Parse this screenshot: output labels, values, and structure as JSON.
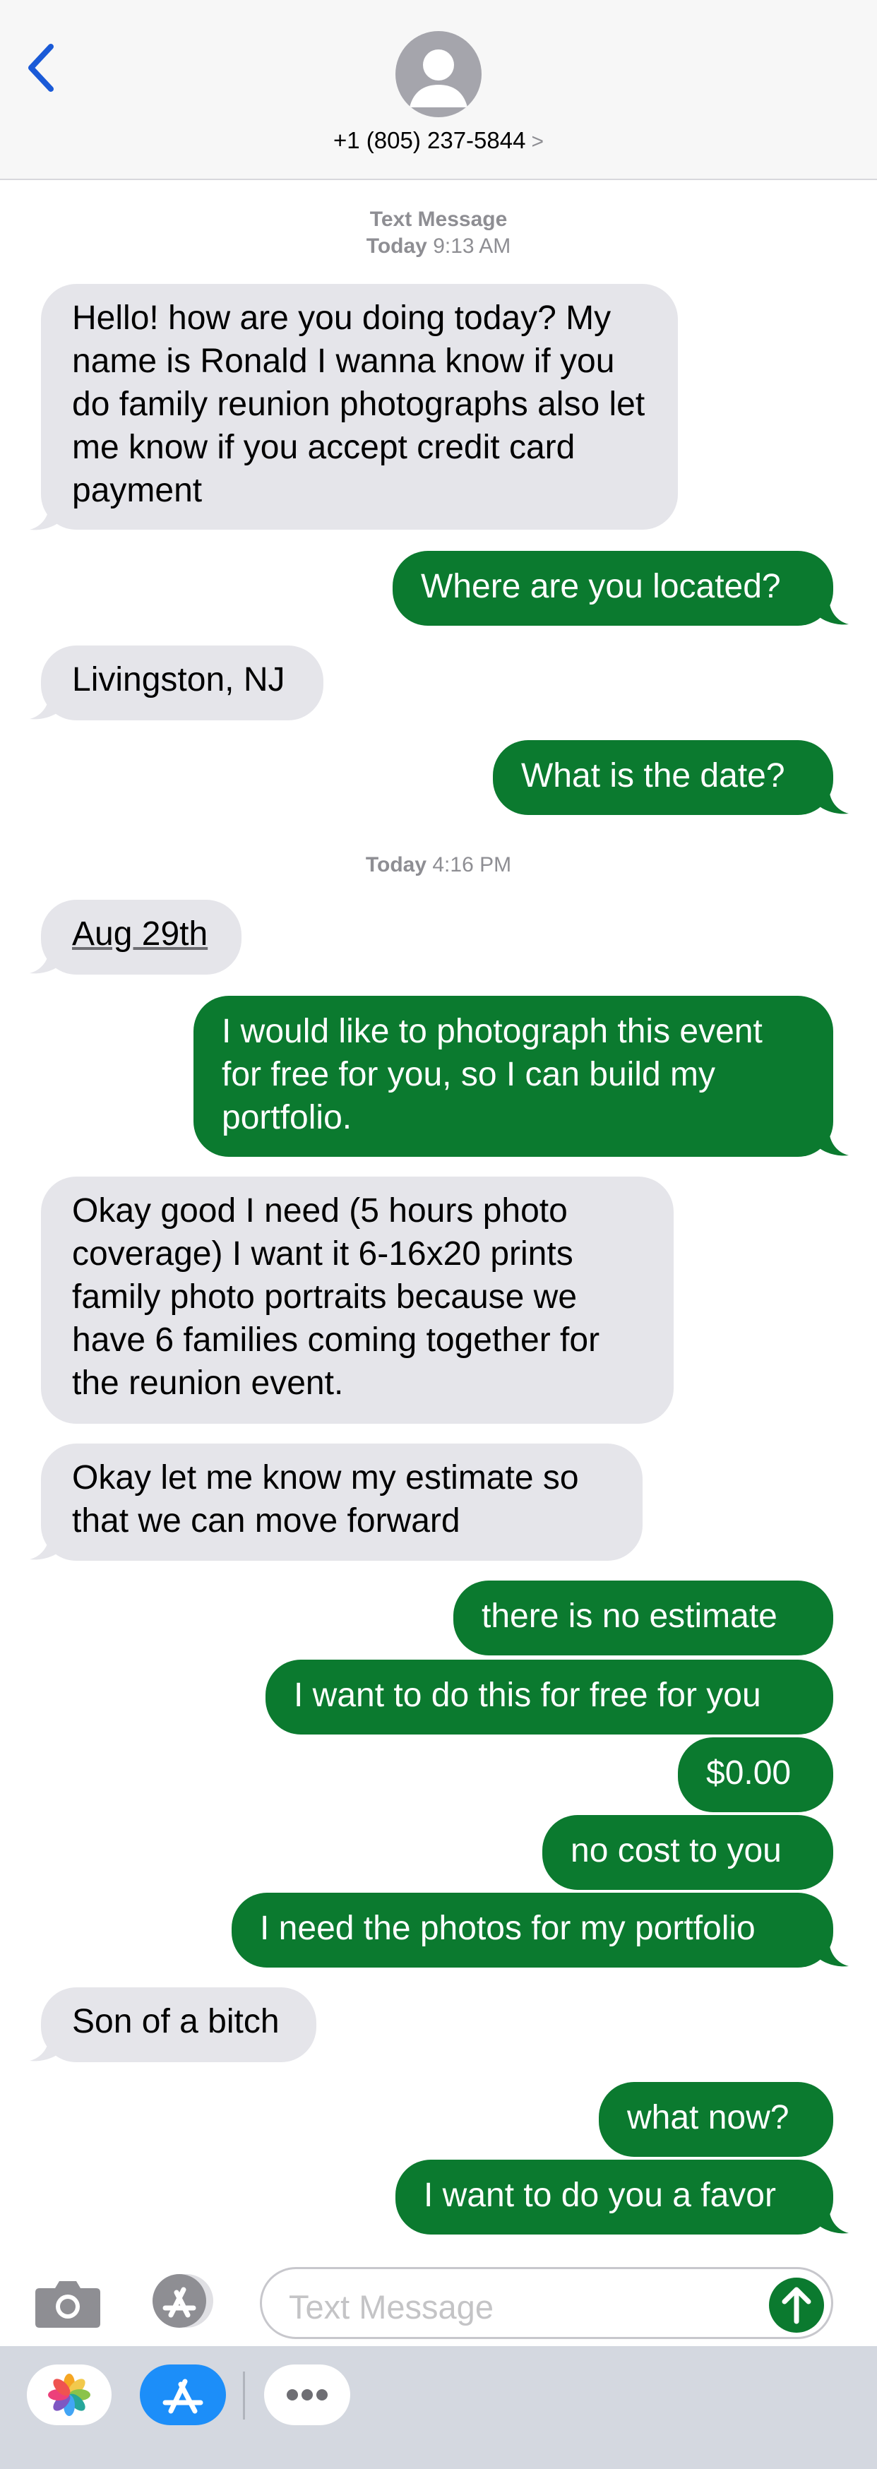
{
  "header": {
    "contact": "+1 (805) 237-5844",
    "chevron": ">"
  },
  "stamps": [
    {
      "label": "Text Message",
      "day": "Today",
      "time": "9:13 AM"
    },
    {
      "day": "Today",
      "time": "4:16 PM"
    }
  ],
  "messages": [
    {
      "dir": "in",
      "text": "Hello! how are you doing today? My name is Ronald I wanna know if you do family reunion photographs also let me know if you accept credit card payment"
    },
    {
      "dir": "out",
      "text": "Where are you located?"
    },
    {
      "dir": "in",
      "text": "Livingston, NJ"
    },
    {
      "dir": "out",
      "text": "What is the date?"
    },
    {
      "dir": "in",
      "text": "Aug 29th"
    },
    {
      "dir": "out",
      "text": "I would like to photograph this event for free for you, so I can build my portfolio."
    },
    {
      "dir": "in",
      "text": "Okay good I need (5 hours photo coverage) I want it 6-16x20 prints family photo portraits because we have 6 families coming together for the reunion event."
    },
    {
      "dir": "in",
      "text": "Okay let me know my estimate so that we can move forward"
    },
    {
      "dir": "out",
      "text": "there is no estimate"
    },
    {
      "dir": "out",
      "text": "I want to do this for free for you"
    },
    {
      "dir": "out",
      "text": "$0.00"
    },
    {
      "dir": "out",
      "text": "no cost to you"
    },
    {
      "dir": "out",
      "text": "I need the photos for my portfolio"
    },
    {
      "dir": "in",
      "text": "Son of a bitch"
    },
    {
      "dir": "out",
      "text": "what now?"
    },
    {
      "dir": "out",
      "text": "I want to do you a favor"
    }
  ],
  "input": {
    "placeholder": "Text Message"
  },
  "icons": {
    "back": "chevron-left-icon",
    "avatar": "person-icon",
    "camera": "camera-icon",
    "apps": "app-store-icon",
    "send": "arrow-up-icon",
    "photos": "photos-icon",
    "more": "ellipsis-icon"
  },
  "colors": {
    "accent": "#0b7a2f",
    "incoming": "#e5e5ea",
    "link": "#1a5ad7"
  }
}
